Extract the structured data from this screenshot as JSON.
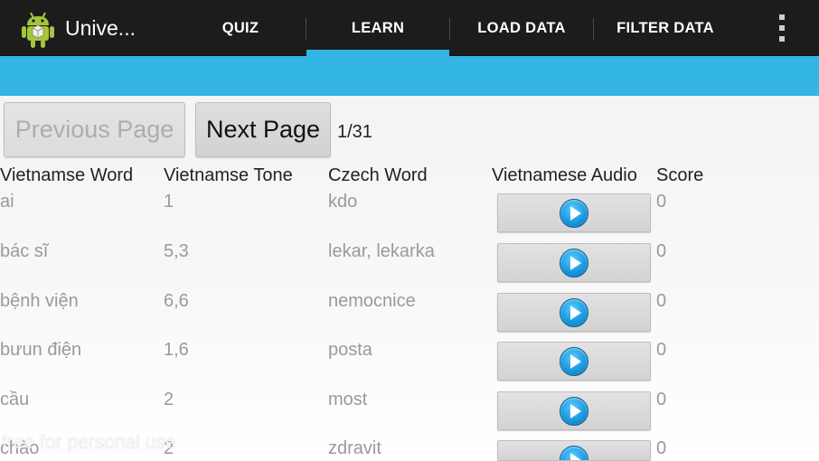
{
  "app": {
    "icon": "android-robot-icon",
    "title": "Unive..."
  },
  "tabs": [
    {
      "label": "QUIZ",
      "selected": false
    },
    {
      "label": "LEARN",
      "selected": true
    },
    {
      "label": "LOAD DATA",
      "selected": false
    },
    {
      "label": "FILTER DATA",
      "selected": false
    }
  ],
  "colors": {
    "accent": "#33b5e5",
    "actionbar": "#1c1c1c",
    "muted_text": "#9a9a9a"
  },
  "pager": {
    "previous_label": "Previous Page",
    "previous_enabled": false,
    "next_label": "Next Page",
    "page_indicator": "1/31"
  },
  "table": {
    "headers": [
      "Vietnamse Word",
      "Vietnamse Tone",
      "Czech Word",
      "Vietnamese Audio",
      "Score"
    ],
    "rows": [
      {
        "word": "ai",
        "tone": "1",
        "czech": "kdo",
        "score": "0"
      },
      {
        "word": "bác sĩ",
        "tone": "5,3",
        "czech": "lekar, lekarka",
        "score": "0"
      },
      {
        "word": "bệnh viện",
        "tone": "6,6",
        "czech": "nemocnice",
        "score": "0"
      },
      {
        "word": "bưun điện",
        "tone": "1,6",
        "czech": "posta",
        "score": "0"
      },
      {
        "word": "cầu",
        "tone": "2",
        "czech": "most",
        "score": "0"
      },
      {
        "word": "chào",
        "tone": "2",
        "czech": "zdravit",
        "score": "0"
      }
    ]
  },
  "watermark": "free for personal use"
}
